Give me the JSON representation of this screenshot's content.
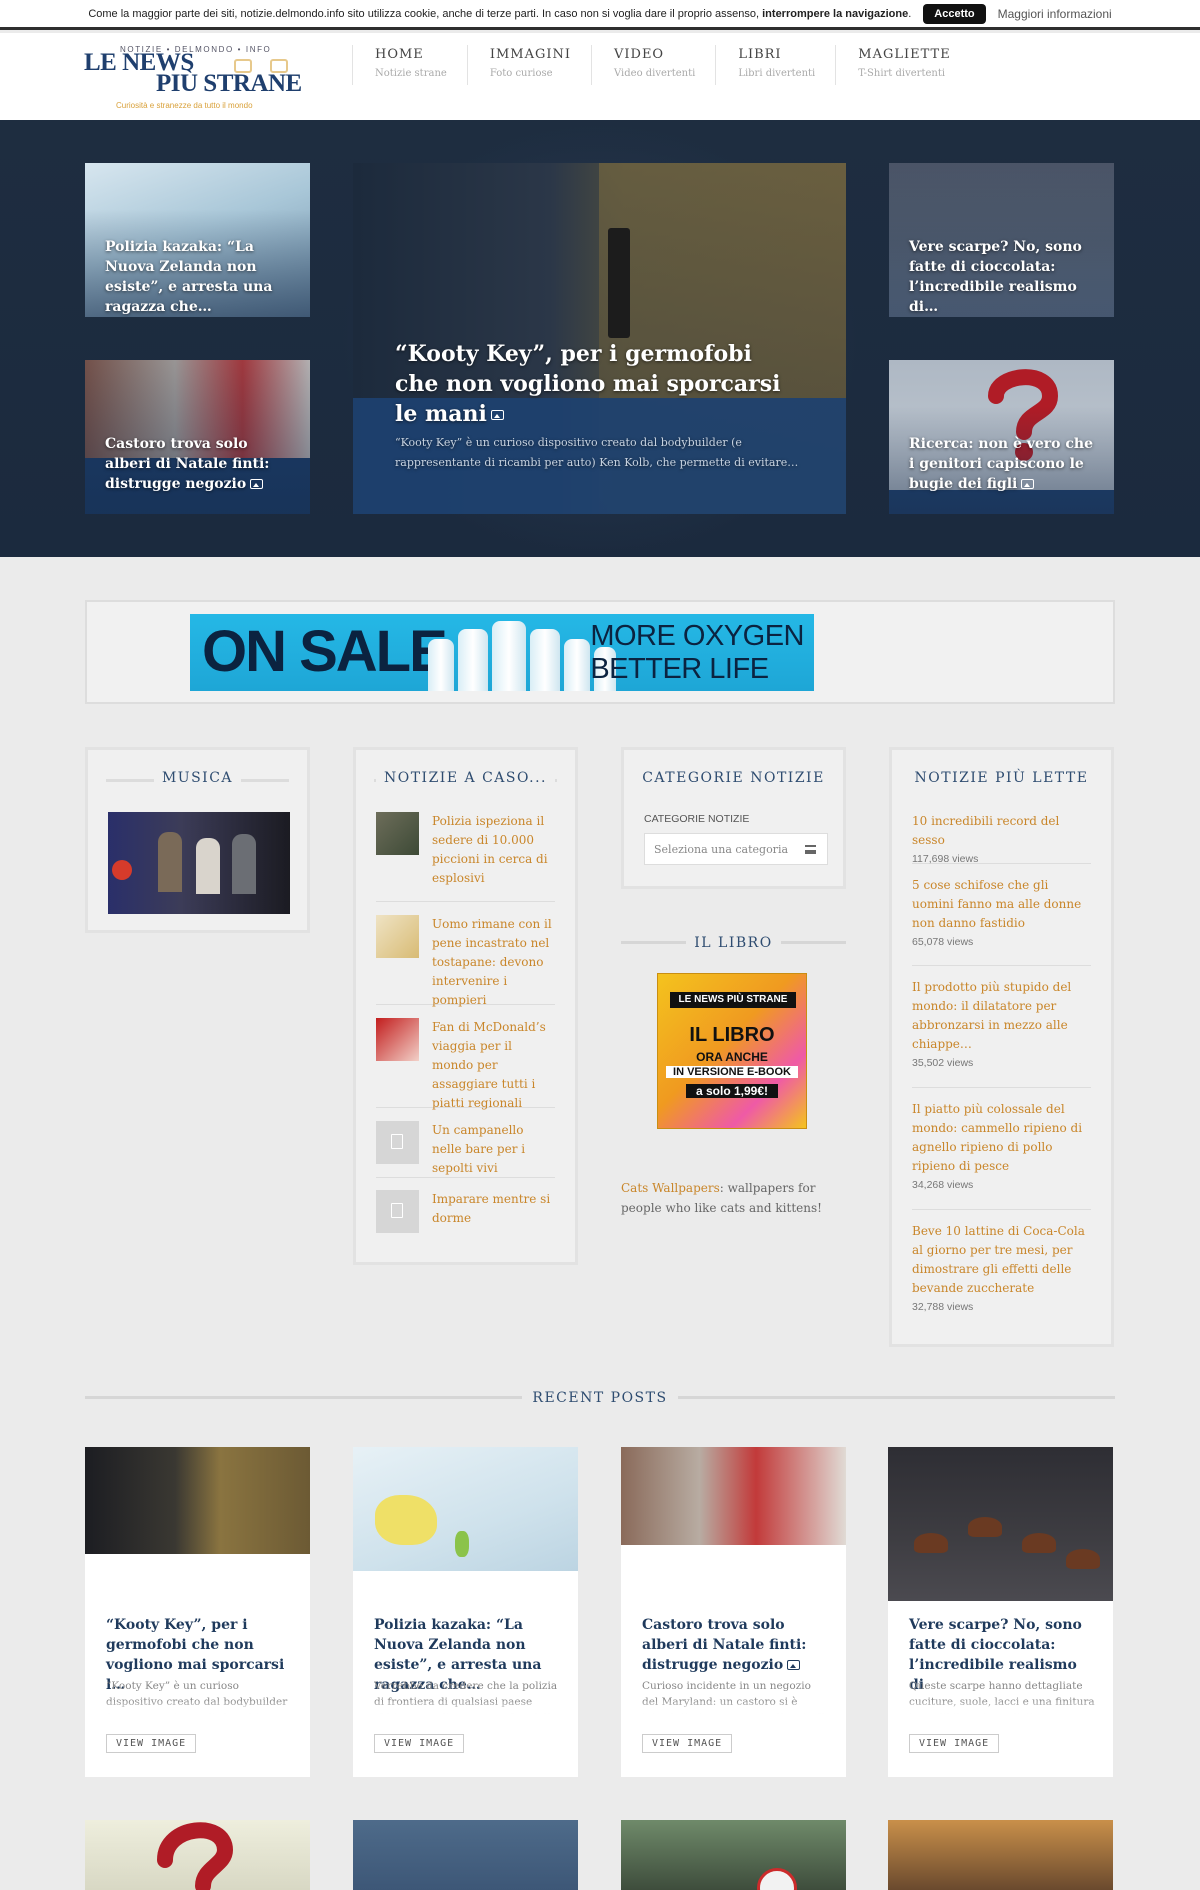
{
  "cookie": {
    "text": "Come la maggior parte dei siti, notizie.delmondo.info sito utilizza cookie, anche di terze parti. In caso non si voglia dare il proprio assenso,",
    "bold": "interrompere la navigazione",
    "accept": "Accetto",
    "more": "Maggiori informazioni"
  },
  "logo": {
    "top": "NOTIZIE  •  DELMONDO  •  INFO",
    "line1": "LE NEWS",
    "line2": "PIÙ STRANE",
    "tagline": "Curiosità e stranezze da tutto il mondo"
  },
  "nav": [
    {
      "label": "HOME",
      "sub": "Notizie strane"
    },
    {
      "label": "IMMAGINI",
      "sub": "Foto curiose"
    },
    {
      "label": "VIDEO",
      "sub": "Video divertenti"
    },
    {
      "label": "LIBRI",
      "sub": "Libri divertenti"
    },
    {
      "label": "MAGLIETTE",
      "sub": "T-Shirt divertenti"
    }
  ],
  "hero": {
    "left_top": "Polizia kazaka: “La Nuova Zelanda non esiste”, e arresta una ragazza che…",
    "left_bottom": "Castoro trova solo alberi di Natale finti: distrugge negozio",
    "main_title": "“Kooty Key”, per i germofobi che non vogliono mai sporcarsi le mani",
    "main_excerpt": "“Kooty Key” è un curioso dispositivo creato dal bodybuilder (e rappresentante di ricambi per auto) Ken Kolb, che permette di evitare…",
    "right_top": "Vere scarpe? No, sono fatte di cioccolata: l’incredibile realismo di…",
    "right_bottom": "Ricerca: non è vero che i genitori capiscono le bugie dei figli"
  },
  "ad": {
    "left": "ON SALE",
    "right_1": "MORE OXYGEN",
    "right_2": "BETTER LIFE"
  },
  "widgets": {
    "musica": "MUSICA",
    "random": {
      "title": "NOTIZIE A CASO...",
      "items": [
        "Polizia ispeziona il sedere di 10.000 piccioni in cerca di esplosivi",
        "Uomo rimane con il pene incastrato nel tostapane: devono intervenire i pompieri",
        "Fan di McDonald’s viaggia per il mondo per assaggiare tutti i piatti regionali",
        "Un campanello nelle bare per i sepolti vivi",
        "Imparare mentre si dorme"
      ]
    },
    "categorie": {
      "title": "CATEGORIE NOTIZIE",
      "label": "CATEGORIE NOTIZIE",
      "placeholder": "Seleziona una categoria"
    },
    "libro": {
      "title": "IL LIBRO",
      "book_head": "LE NEWS PIÙ STRANE",
      "book_l1": "IL LIBRO",
      "book_l2": "ORA ANCHE",
      "book_l3": "IN VERSIONE E-BOOK",
      "book_l4": "a solo 1,99€!",
      "link": "Cats Wallpapers",
      "link_rest": ": wallpapers for people who like cats and kittens!"
    },
    "popular": {
      "title": "NOTIZIE PIÙ LETTE",
      "items": [
        {
          "t": "10 incredibili record del sesso",
          "v": "117,698 views"
        },
        {
          "t": "5 cose schifose che gli uomini fanno ma alle donne non danno fastidio",
          "v": "65,078 views"
        },
        {
          "t": "Il prodotto più stupido del mondo: il dilatatore per abbronzarsi in mezzo alle chiappe…",
          "v": "35,502 views"
        },
        {
          "t": "Il piatto più colossale del mondo: cammello ripieno di agnello ripieno di pollo ripieno di pesce",
          "v": "34,268 views"
        },
        {
          "t": "Beve 10 lattine di Coca-Cola al giorno per tre mesi, per dimostrare gli effetti delle bevande zuccherate",
          "v": "32,788 views"
        }
      ]
    }
  },
  "recent": {
    "title": "RECENT POSTS",
    "button": "VIEW IMAGE",
    "cards": [
      {
        "t": "“Kooty Key”, per i germofobi che non vogliono mai sporcarsi l…",
        "ex": "“Kooty Key” è un curioso dispositivo creato dal bodybuilder (e rappresentante di ricambi per auto)"
      },
      {
        "t": "Polizia kazaka: “La Nuova Zelanda non esiste”, e arresta una ragazza che…",
        "ex": "Verrebbe da credere che la polizia di frontiera di qualsiasi paese abbia una cultura geografica della"
      },
      {
        "t": "Castoro trova solo alberi di Natale finti: distrugge negozio",
        "ex": "Curioso incidente in un negozio del Maryland: un castoro si è introdotto in un negozio di articoli da"
      },
      {
        "t": "Vere scarpe? No, sono fatte di cioccolata: l’incredibile realismo di",
        "ex": "Queste scarpe hanno dettagliate cuciture, suole, lacci e una finitura incredibilmente realistica"
      }
    ]
  }
}
